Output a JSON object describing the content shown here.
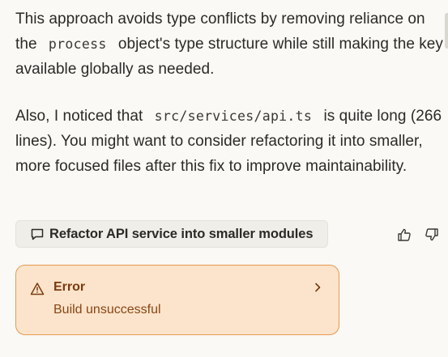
{
  "message": {
    "para1": {
      "before": "This approach avoids type conflicts by removing reliance on the",
      "code": "process",
      "after": "object's type structure while still making the key available globally as needed."
    },
    "para2": {
      "before": "Also, I noticed that",
      "code": "src/services/api.ts",
      "after": "is quite long (266 lines). You might want to consider refactoring it into smaller, more focused files after this fix to improve maintainability."
    }
  },
  "suggestion": {
    "label": "Refactor API service into smaller modules",
    "icon": "chat-bubble-icon"
  },
  "feedback": {
    "thumbs_up_icon": "thumbs-up-icon",
    "thumbs_down_icon": "thumbs-down-icon"
  },
  "error": {
    "title": "Error",
    "subtitle": "Build unsuccessful",
    "icon": "warning-icon",
    "chevron": "chevron-right-icon",
    "colors": {
      "background": "#fbe4cb",
      "border": "#e69a52",
      "text": "#7a3b10"
    }
  }
}
